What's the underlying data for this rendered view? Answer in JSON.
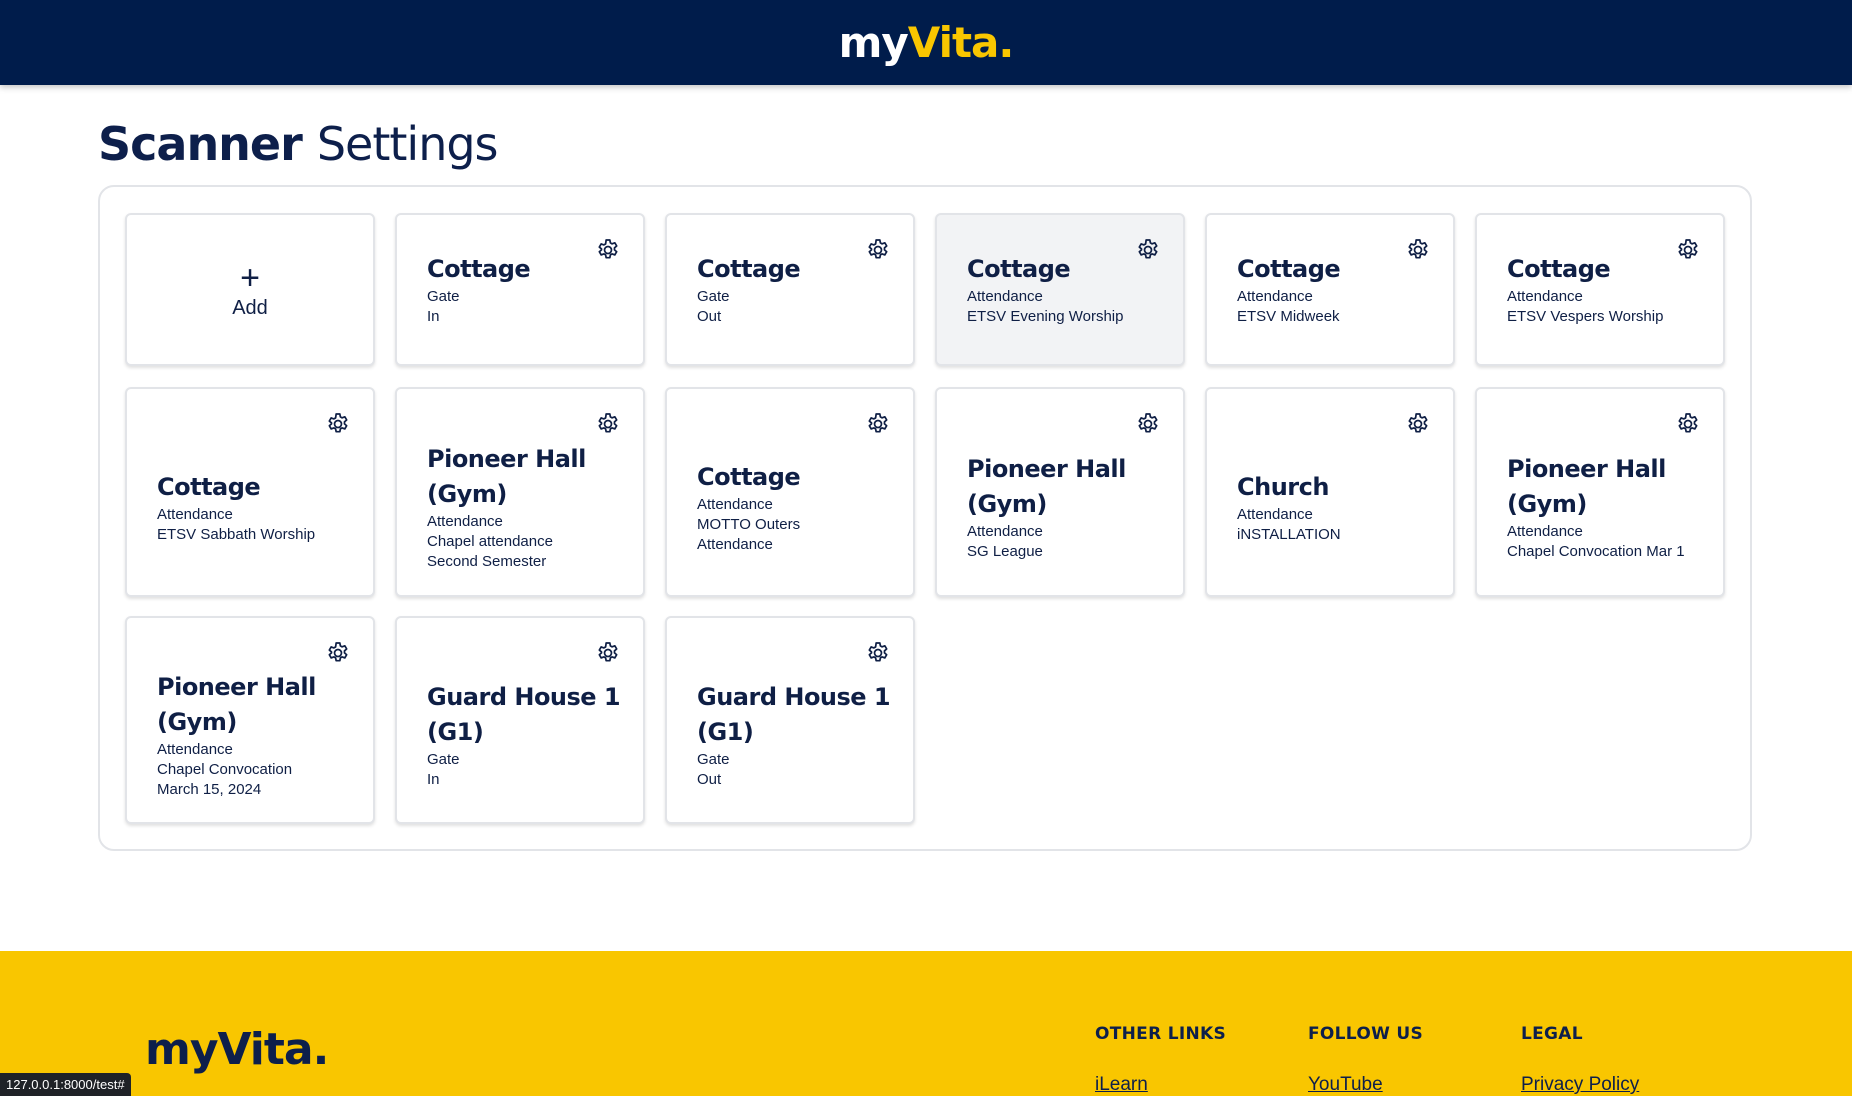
{
  "header": {
    "logo_my": "my",
    "logo_vita": "Vita",
    "logo_dot": "."
  },
  "page": {
    "title_bold": "Scanner",
    "title_light": "Settings"
  },
  "add_card": {
    "plus": "+",
    "label": "Add"
  },
  "cards": [
    {
      "title": "Cottage",
      "lines": [
        "Gate",
        "In"
      ]
    },
    {
      "title": "Cottage",
      "lines": [
        "Gate",
        "Out"
      ]
    },
    {
      "title": "Cottage",
      "lines": [
        "Attendance",
        "ETSV Evening Worship"
      ]
    },
    {
      "title": "Cottage",
      "lines": [
        "Attendance",
        "ETSV Midweek"
      ]
    },
    {
      "title": "Cottage",
      "lines": [
        "Attendance",
        "ETSV Vespers Worship"
      ]
    },
    {
      "title": "Cottage",
      "lines": [
        "Attendance",
        "ETSV Sabbath Worship"
      ]
    },
    {
      "title": "Pioneer Hall (Gym)",
      "lines": [
        "Attendance",
        "Chapel attendance",
        "Second Semester"
      ]
    },
    {
      "title": "Cottage",
      "lines": [
        "Attendance",
        "MOTTO Outers",
        "Attendance"
      ]
    },
    {
      "title": "Pioneer Hall (Gym)",
      "lines": [
        "Attendance",
        "SG League"
      ]
    },
    {
      "title": "Church",
      "lines": [
        "Attendance",
        "iNSTALLATION"
      ]
    },
    {
      "title": "Pioneer Hall (Gym)",
      "lines": [
        "Attendance",
        "Chapel Convocation Mar 1"
      ]
    },
    {
      "title": "Pioneer Hall (Gym)",
      "lines": [
        "Attendance",
        "Chapel Convocation",
        "March 15, 2024"
      ]
    },
    {
      "title": "Guard House 1 (G1)",
      "lines": [
        "Gate",
        "In"
      ]
    },
    {
      "title": "Guard House 1 (G1)",
      "lines": [
        "Gate",
        "Out"
      ]
    }
  ],
  "footer": {
    "logo_my": "my",
    "logo_vita": "Vita",
    "logo_dot": ".",
    "columns": [
      {
        "heading": "OTHER LINKS",
        "link": "iLearn"
      },
      {
        "heading": "FOLLOW US",
        "link": "YouTube"
      },
      {
        "heading": "LEGAL",
        "link": "Privacy Policy"
      }
    ]
  },
  "status_bar": {
    "url": "127.0.0.1:8000/test#"
  },
  "colors": {
    "navy": "#001c4b",
    "yellow": "#f9c600",
    "card_hover": "#f2f3f5"
  },
  "icons": {
    "settings": "gear-icon",
    "add": "plus-icon"
  }
}
